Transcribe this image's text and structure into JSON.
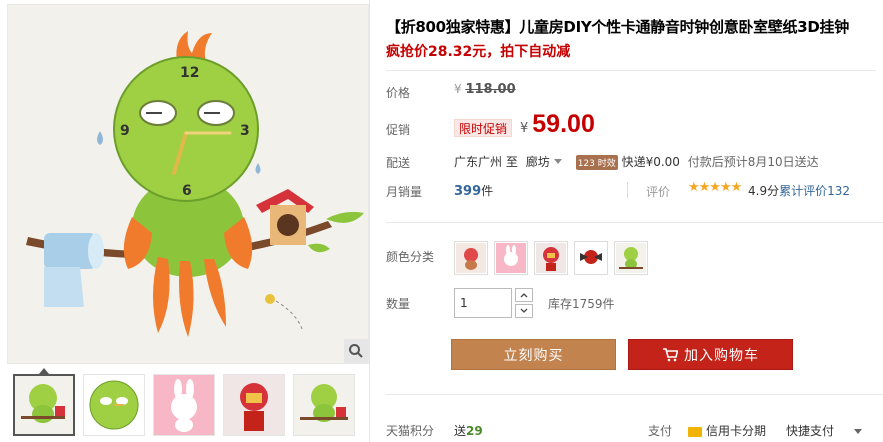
{
  "product": {
    "title": "【折800独家特惠】儿童房DIY个性卡通静音时钟创意卧室壁纸3D挂钟",
    "subtitle": "疯抢价28.32元，拍下自动减"
  },
  "price": {
    "label": "价格",
    "currency": "¥",
    "original": "118.00",
    "promo_label": "促销",
    "promo_tag": "限时促销",
    "promo_price": "59.00"
  },
  "shipping": {
    "label": "配送",
    "origin": "广东广州",
    "to": "至",
    "destination": "廊坊",
    "badge": "123 时效",
    "fee": "快递¥0.00",
    "note": "付款后预计8月10日送达"
  },
  "sales": {
    "label": "月销量",
    "count": "399",
    "unit": "件",
    "review_label": "评价",
    "stars": "★★★★★",
    "score": "4.9分",
    "review_link": "累计评价132"
  },
  "options": {
    "color_label": "颜色分类",
    "swatches": [
      "owl-clock",
      "bunny-clock",
      "ironman-clock",
      "fairy-clock",
      "green-owl-clock"
    ]
  },
  "quantity": {
    "label": "数量",
    "value": "1",
    "stock": "库存1759件"
  },
  "actions": {
    "buy_now": "立刻购买",
    "add_to_cart": "加入购物车"
  },
  "footer": {
    "points_label": "天猫积分",
    "points_prefix": "送",
    "points_value": "29",
    "pay_label": "支付",
    "pay_credit": "信用卡分期",
    "pay_quick": "快捷支付"
  },
  "colors": {
    "accent_red": "#c40000",
    "buy_button": "#c3834f",
    "cart_button": "#c4231a",
    "link_blue": "#336699",
    "star_gold": "#f5a623"
  }
}
